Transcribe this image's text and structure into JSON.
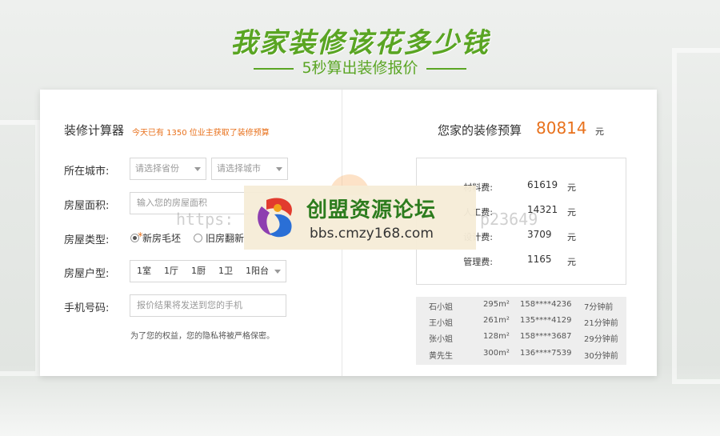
{
  "hero": {
    "title": "我家装修该花多少钱",
    "subtitle": "5秒算出装修报价"
  },
  "calculator": {
    "title": "装修计算器",
    "note": "今天已有 1350 位业主获取了装修预算",
    "city": {
      "label": "所在城市:",
      "star": "*",
      "province_placeholder": "请选择省份",
      "city_placeholder": "请选择城市"
    },
    "area": {
      "label": "房屋面积:",
      "star": "*",
      "placeholder": "输入您的房屋面积"
    },
    "type": {
      "label": "房屋类型:",
      "star": "*",
      "options": [
        "新房毛坯",
        "旧房翻新"
      ],
      "selected": "新房毛坯"
    },
    "layout": {
      "label": "房屋户型:",
      "star": "*",
      "items": [
        "1室",
        "1厅",
        "1厨",
        "1卫",
        "1阳台"
      ]
    },
    "phone": {
      "label": "手机号码:",
      "star": "*",
      "placeholder": "报价结果将发送到您的手机"
    },
    "privacy": "为了您的权益，您的隐私将被严格保密。"
  },
  "budget": {
    "title": "您家的装修预算",
    "value": "80814",
    "unit": "元",
    "breakdown": [
      {
        "key": "材料费:",
        "value": "61619",
        "unit": "元"
      },
      {
        "key": "人工费:",
        "value": "14321",
        "unit": "元"
      },
      {
        "key": "设计费:",
        "value": "3709",
        "unit": "元"
      },
      {
        "key": "管理费:",
        "value": "1165",
        "unit": "元"
      }
    ]
  },
  "records": [
    {
      "name": "石小姐",
      "area": "295m²",
      "phone": "158****4236",
      "time": "7分钟前"
    },
    {
      "name": "王小姐",
      "area": "261m²",
      "phone": "135****4129",
      "time": "21分钟前"
    },
    {
      "name": "张小姐",
      "area": "128m²",
      "phone": "158****3687",
      "time": "29分钟前"
    },
    {
      "name": "黄先生",
      "area": "300m²",
      "phone": "136****7539",
      "time": "30分钟前"
    }
  ],
  "watermark": {
    "name": "创盟资源论坛",
    "url": "bbs.cmzy168.com",
    "ghost_left": "https:",
    "ghost_right": "p23649"
  },
  "colors": {
    "brand_green": "#5aa523",
    "accent_orange": "#e8711c"
  }
}
